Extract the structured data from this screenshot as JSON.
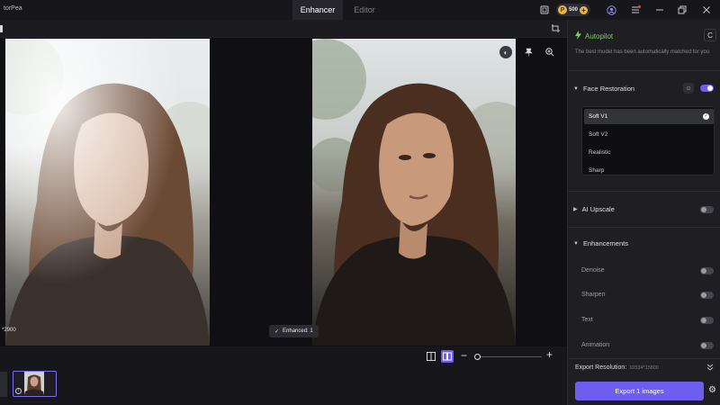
{
  "app": {
    "name": "torPea"
  },
  "tabs": [
    {
      "label": "Enhancer",
      "active": true
    },
    {
      "label": "Editor",
      "active": false
    }
  ],
  "titlebar": {
    "credits": "500",
    "coin_symbol": "P",
    "icons": [
      "crop-frame-icon",
      "coin-icon",
      "plus-icon",
      "user-icon",
      "notification-menu-icon",
      "minimize-icon",
      "restore-icon",
      "close-icon"
    ]
  },
  "canvas": {
    "resolution_label": "*2900",
    "enhanced_label": "Enhanced: 1",
    "icons": [
      "compare-icon",
      "pin-icon",
      "zoom-in-icon"
    ]
  },
  "bottom": {
    "zoom_minus": "−",
    "zoom_plus": "+",
    "thumb_info": "i",
    "zoom_level": 0
  },
  "panel": {
    "autopilot_title": "Autopilot",
    "autopilot_desc": "The best model has been automatically matched for you",
    "face_restoration": {
      "label": "Face Restoration",
      "enabled": true,
      "models": [
        {
          "label": "Soft V1",
          "selected": true
        },
        {
          "label": "Soft V2",
          "selected": false
        },
        {
          "label": "Realistic",
          "selected": false
        },
        {
          "label": "Sharp",
          "selected": false
        }
      ]
    },
    "ai_upscale": {
      "label": "AI Upscale",
      "enabled": false
    },
    "enhancements": {
      "label": "Enhancements",
      "items": [
        {
          "label": "Denoise",
          "enabled": false
        },
        {
          "label": "Sharpen",
          "enabled": false
        },
        {
          "label": "Text",
          "enabled": false
        },
        {
          "label": "Animation",
          "enabled": false
        }
      ]
    },
    "export_resolution_label": "Export Resolution:",
    "export_resolution_value": "10534*15800",
    "export_button": "Export 1 images"
  },
  "colors": {
    "accent": "#6e5ef0",
    "autopilot_green": "#7cd35e",
    "coin_gold": "#e7b54a"
  }
}
